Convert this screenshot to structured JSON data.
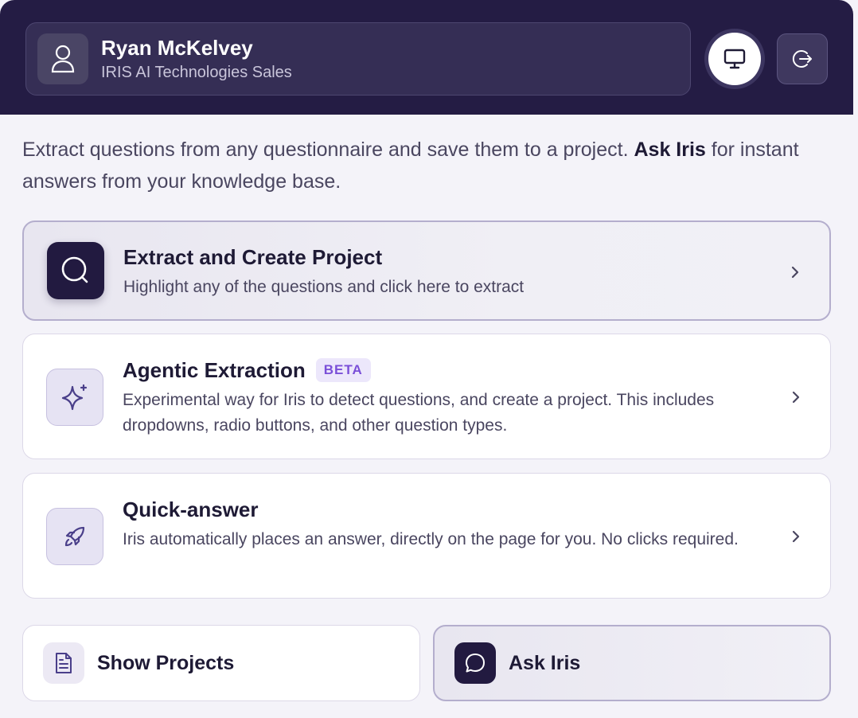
{
  "user": {
    "name": "Ryan McKelvey",
    "org": "IRIS AI Technologies Sales"
  },
  "intro": {
    "text_before": "Extract questions from any questionnaire and save them to a project. ",
    "highlight": "Ask Iris",
    "text_after": " for instant answers from your knowledge base."
  },
  "options": [
    {
      "title": "Extract and Create Project",
      "description": "Highlight any of the questions and click here to extract",
      "icon": "search-icon"
    },
    {
      "title": "Agentic Extraction",
      "badge": "BETA",
      "description": "Experimental way for Iris to detect questions, and create a project. This includes dropdowns, radio buttons, and other question types.",
      "icon": "sparkle-icon"
    },
    {
      "title": "Quick-answer",
      "description": "Iris automatically places an answer, directly on the page for you. No clicks required.",
      "icon": "rocket-icon"
    }
  ],
  "actions": {
    "show_projects": "Show Projects",
    "ask_iris": "Ask Iris"
  },
  "colors": {
    "header_bg": "#241c44",
    "accent_dark": "#221a40",
    "badge_text": "#7a4fd8",
    "page_bg": "#f4f3f9"
  }
}
